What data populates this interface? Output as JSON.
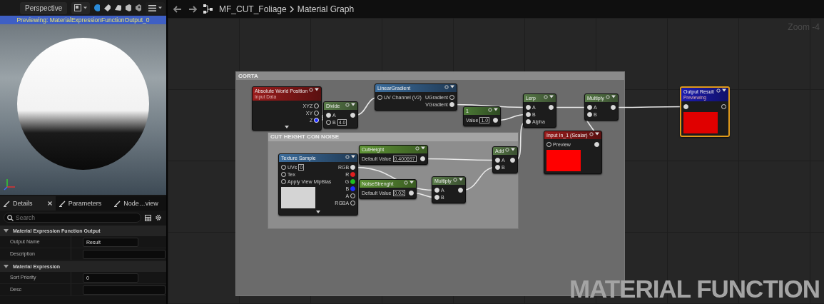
{
  "viewport": {
    "mode": "Perspective",
    "banner": "Previewing: MaterialExpressionFunctionOutput_0"
  },
  "panel_tabs": [
    {
      "label": "Details",
      "selected": true,
      "closable": true
    },
    {
      "label": "Parameters",
      "selected": false,
      "closable": false
    },
    {
      "label": "Node…view",
      "selected": false,
      "closable": false
    }
  ],
  "search": {
    "placeholder": "Search"
  },
  "sections": [
    {
      "title": "Material Expression Function Output",
      "expanded": true,
      "rows": [
        {
          "label": "Output Name",
          "value": "Result",
          "kind": "short"
        },
        {
          "label": "Description",
          "kind": "wide"
        }
      ]
    },
    {
      "title": "Material Expression",
      "expanded": true,
      "rows": [
        {
          "label": "Sort Priority",
          "value": "0",
          "kind": "short"
        },
        {
          "label": "Desc",
          "kind": "wide"
        }
      ]
    }
  ],
  "breadcrumb": [
    "MF_CUT_Foliage",
    "Material Graph"
  ],
  "zoom": "Zoom -4",
  "comments": [
    {
      "title": "CORTA"
    },
    {
      "title": "CUT HEIGHT CON NOISE"
    }
  ],
  "nodes": [
    {
      "title": "Absolute World Position",
      "subtitle": "Input Data",
      "kind": "input",
      "selected": false,
      "expandable": true,
      "outputs": [
        {
          "label": "XYZ",
          "connected": false
        },
        {
          "label": "XY",
          "connected": false
        },
        {
          "label": "Z",
          "connected": true,
          "color": "#1e2cff"
        }
      ]
    },
    {
      "title": "Divide",
      "kind": "math",
      "selected": false,
      "expandable": false,
      "inputs": [
        {
          "kind": "pin",
          "label": "A",
          "connected": true
        },
        {
          "kind": "pin",
          "label": "B",
          "connected": false,
          "value": "4.0"
        }
      ],
      "outputs": [
        {
          "connected": true
        }
      ]
    },
    {
      "title": "LinearGradient",
      "kind": "function",
      "selected": false,
      "expandable": false,
      "inputs": [
        {
          "kind": "pin",
          "label": "UV Channel (V2)",
          "connected": false
        }
      ],
      "outputs": [
        {
          "label": "UGradient",
          "connected": false
        },
        {
          "label": "VGradient",
          "connected": true
        }
      ]
    },
    {
      "title": "1",
      "kind": "constant",
      "selected": false,
      "expandable": false,
      "inputs": [
        {
          "kind": "field",
          "label": "Value",
          "value": "1.0"
        }
      ],
      "outputs": [
        {
          "connected": true
        }
      ]
    },
    {
      "title": "Lerp",
      "kind": "math",
      "selected": false,
      "expandable": false,
      "inputs": [
        {
          "kind": "pin",
          "label": "A",
          "connected": true
        },
        {
          "kind": "pin",
          "label": "B",
          "connected": true
        },
        {
          "kind": "pin",
          "label": "Alpha",
          "connected": true
        }
      ],
      "outputs": [
        {
          "connected": true
        }
      ]
    },
    {
      "title": "Multiply",
      "kind": "math",
      "selected": false,
      "expandable": false,
      "inputs": [
        {
          "kind": "pin",
          "label": "A",
          "connected": true
        },
        {
          "kind": "pin",
          "label": "B",
          "connected": true
        }
      ],
      "outputs": [
        {
          "connected": true
        }
      ]
    },
    {
      "title": "Input In_1 (Scalar)",
      "kind": "input",
      "selected": false,
      "expandable": false,
      "inputs": [
        {
          "kind": "pin",
          "label": "Preview",
          "connected": false
        }
      ],
      "outputs": [
        {
          "connected": true
        }
      ],
      "preview": {
        "color": "#ff0000"
      }
    },
    {
      "title": "Output Result",
      "subtitle": "Previewing",
      "kind": "output",
      "selected": true,
      "expandable": false,
      "inputs": [
        {
          "kind": "pin",
          "connected": true
        }
      ],
      "outputs": [
        {
          "connected": false
        }
      ],
      "preview": {
        "color": "#e00000"
      }
    },
    {
      "title": "Texture Sample",
      "kind": "function",
      "selected": false,
      "expandable": true,
      "inputs": [
        {
          "kind": "pin",
          "label": "UVs",
          "connected": false,
          "value": "0"
        },
        {
          "kind": "pin",
          "label": "Tex",
          "connected": false
        },
        {
          "kind": "pin",
          "label": "Apply View MipBias",
          "connected": false
        }
      ],
      "outputs": [
        {
          "label": "RGB",
          "connected": true
        },
        {
          "label": "R",
          "connected": false,
          "color": "#e02020"
        },
        {
          "label": "G",
          "connected": false,
          "color": "#20c020"
        },
        {
          "label": "B",
          "connected": false,
          "color": "#2030ff"
        },
        {
          "label": "A",
          "connected": false
        },
        {
          "label": "RGBA",
          "connected": false
        }
      ],
      "preview": {
        "color": "#d4d4d4"
      }
    },
    {
      "title": "CutHeight",
      "kind": "param",
      "selected": false,
      "expandable": false,
      "inputs": [
        {
          "kind": "field",
          "label": "Default Value",
          "value": "0.400697"
        }
      ],
      "outputs": [
        {
          "connected": true
        }
      ]
    },
    {
      "title": "NoiseStrenght",
      "kind": "param",
      "selected": false,
      "expandable": false,
      "inputs": [
        {
          "kind": "field",
          "label": "Default Value",
          "value": "0.02"
        }
      ],
      "outputs": [
        {
          "connected": true
        }
      ]
    },
    {
      "title": "Multiply",
      "kind": "math",
      "selected": false,
      "expandable": false,
      "inputs": [
        {
          "kind": "pin",
          "label": "A",
          "connected": true
        },
        {
          "kind": "pin",
          "label": "B",
          "connected": true
        }
      ],
      "outputs": [
        {
          "connected": true
        }
      ]
    },
    {
      "title": "Add",
      "kind": "math",
      "selected": false,
      "expandable": false,
      "inputs": [
        {
          "kind": "pin",
          "label": "A",
          "connected": true
        },
        {
          "kind": "pin",
          "label": "B",
          "connected": true
        }
      ],
      "outputs": [
        {
          "connected": true
        }
      ]
    }
  ],
  "graph_type_label": "MATERIAL FUNCTION"
}
